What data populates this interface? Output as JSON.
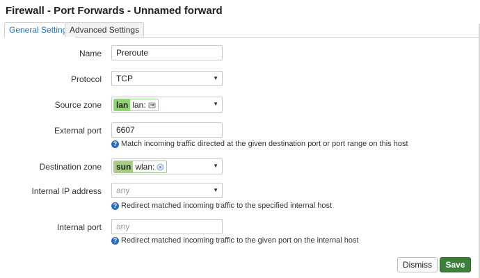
{
  "header": {
    "title": "Firewall - Port Forwards - Unnamed forward"
  },
  "tabs": [
    {
      "label": "General Settings",
      "active": true
    },
    {
      "label": "Advanced Settings",
      "active": false
    }
  ],
  "form": {
    "name": {
      "label": "Name",
      "value": "Preroute"
    },
    "protocol": {
      "label": "Protocol",
      "value": "TCP"
    },
    "source_zone": {
      "label": "Source zone",
      "zone": "lan",
      "interface": "lan:",
      "color": "#90d46f"
    },
    "external_port": {
      "label": "External port",
      "value": "6607",
      "help": "Match incoming traffic directed at the given destination port or port range on this host"
    },
    "destination_zone": {
      "label": "Destination zone",
      "zone": "sun",
      "interface": "wlan:",
      "color": "#a6cc86"
    },
    "internal_ip": {
      "label": "Internal IP address",
      "placeholder": "any",
      "help": "Redirect matched incoming traffic to the specified internal host"
    },
    "internal_port": {
      "label": "Internal port",
      "placeholder": "any",
      "help": "Redirect matched incoming traffic to the given port on the internal host"
    }
  },
  "actions": {
    "dismiss": "Dismiss",
    "save": "Save"
  },
  "colors": {
    "accent": "#2a6ebb",
    "save": "#3d7f3a"
  }
}
